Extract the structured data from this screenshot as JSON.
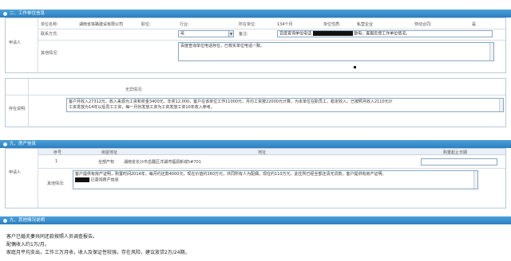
{
  "sections": {
    "s1": "二、工作单位信息",
    "s2": "九、房产信息",
    "s3": "九、其他情况说明"
  },
  "work": {
    "group_label": "申请人",
    "unit_name_label": "单位名称:",
    "unit_name_value": "湖南省铁路建设有限公司",
    "position_label": "职位:",
    "industry_label": "行业:",
    "duty_label": "所在单位:",
    "duty_value": "134个月",
    "unit_type_label": "单位性质:",
    "unit_type_value": "私营企业",
    "contract_label": "劳动合同:",
    "contract_value": "是",
    "verify_label": "联系方式:",
    "verify_select": "是",
    "remark_label": "备注:",
    "phone_desc_a": "百度查询单位电话",
    "phone_desc_b": "致电，客服反馈工作单位情况。",
    "other_label": "其他情况:",
    "other_value": "百度查询单位电话存在，已核实单位电话一致。"
  },
  "income": {
    "note_label": "无异情况:",
    "desc_label": "存在说明:",
    "desc_line1": "客户月收入27312元，收入来源为工资和奖金3400元，年奖12,000，客户在该单位工作11000元，月均工资按22000元计算，为本单位在职员工，稳定收入，已按照月收入2110元计",
    "desc_line2": "工资发放为14年以后员工工资，每一月份发放工资为工资发放工资10年收入参考。"
  },
  "property": {
    "group_label": "申请人",
    "col_no": "序号",
    "col_addr": "房屋地址",
    "col_area": "地址",
    "col_date": "购置起止日期",
    "row_no": "1",
    "row_owner": "全部产权",
    "row_addr": "湖南省长沙市岳麓区洋湖湾福源新城5#701",
    "remark_label": "其他情况:",
    "remark_line1": "客户提供有房产证明，购置时间2014年，每月约还款4000元，现在价值约260万元，共同所有人为配偶，现在约110万元，此住所已经全部还清无贷款，客户提供有房产证明。",
    "remark_line2": "已查询房产信息"
  },
  "other": {
    "line1": "客户已婚夫妻共同还款按照人员调查报告。",
    "line2": "配偶收入约1万/月。",
    "line3": "家庭月平均支出，工作三万月收，收入及保证性较强，存在风险，建议放贷2万/24期。"
  }
}
